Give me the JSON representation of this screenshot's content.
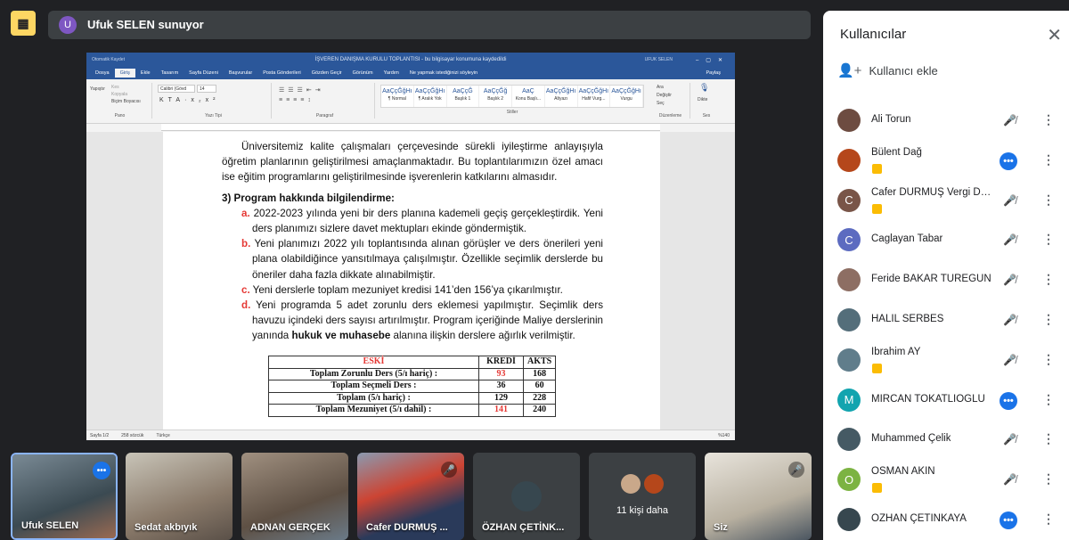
{
  "presenter": {
    "avatar_letter": "U",
    "text": "Ufuk SELEN sunuyor"
  },
  "word": {
    "title": "İŞVEREN DANIŞMA KURULU TOPLANTISI - bu bilgisayar konumuna kaydedildi",
    "user": "UFUK SELEN",
    "autosave": "Otomatik Kaydet",
    "tabs": [
      "Dosya",
      "Giriş",
      "Ekle",
      "Tasarım",
      "Sayfa Düzeni",
      "Başvurular",
      "Posta Gönderileri",
      "Gözden Geçir",
      "Görünüm",
      "Yardım",
      "Ne yapmak istediğinizi söyleyin"
    ],
    "share": "Paylaş",
    "font_name": "Calibri (Gövd",
    "font_size": "14",
    "groups": [
      "Pano",
      "Yazı Tipi",
      "Paragraf",
      "Stiller",
      "Düzenleme",
      "Ses"
    ],
    "clipboard": [
      "Yapıştır",
      "Kes",
      "Kopyala",
      "Biçim Boyacısı"
    ],
    "styles": [
      {
        "sample": "AaÇçĞğHı",
        "name": "¶ Normal"
      },
      {
        "sample": "AaÇçĞğHı",
        "name": "¶ Aralık Yok"
      },
      {
        "sample": "AaÇçĞ",
        "name": "Başlık 1"
      },
      {
        "sample": "AaÇçĞğ",
        "name": "Başlık 2"
      },
      {
        "sample": "AaÇ",
        "name": "Konu Başlı..."
      },
      {
        "sample": "AaÇçĞğHı",
        "name": "Altyazı"
      },
      {
        "sample": "AaÇçĞğHı",
        "name": "Hafif Vurg..."
      },
      {
        "sample": "AaÇçĞğHı",
        "name": "Vurgu"
      }
    ],
    "editing": [
      "Ara",
      "Değiştir",
      "Seç"
    ],
    "dictate": "Dikte",
    "status": [
      "Sayfa 1/2",
      "258 sözcük",
      "Türkçe"
    ],
    "zoom": "%140"
  },
  "document": {
    "intro": "Üniversitemiz kalite çalışmaları çerçevesinde sürekli iyileştirme anlayışıyla öğretim planlarının geliştirilmesi amaçlanmaktadır. Bu toplantılarımızın özel amacı ise eğitim programlarını geliştirilmesinde işverenlerin katkılarını almasıdır.",
    "heading": "3)  Program hakkında bilgilendirme:",
    "items": [
      {
        "marker": "a.",
        "text": " 2022-2023 yılında yeni bir ders planına kademeli geçiş gerçekleştirdik. Yeni ders planımızı sizlere davet mektupları ekinde göndermiştik."
      },
      {
        "marker": "b.",
        "text": " Yeni planımızı 2022 yılı toplantısında alınan görüşler ve ders önerileri yeni plana olabildiğince yansıtılmaya çalışılmıştır. Özellikle seçimlik derslerde bu öneriler daha fazla dikkate alınabilmiştir."
      },
      {
        "marker": "c.",
        "text": " Yeni derslerle toplam mezuniyet kredisi 141’den 156’ya çıkarılmıştır."
      }
    ],
    "item_d": {
      "marker": "d.",
      "pre": " Yeni programda 5 adet zorunlu ders eklemesi yapılmıştır. Seçimlik ders havuzu içindeki ders sayısı artırılmıştır. Program içeriğinde Maliye derslerinin yanında ",
      "bold": "hukuk ve muhasebe",
      "post": " alanına ilişkin derslere ağırlık verilmiştir."
    },
    "table": {
      "headers": [
        "ESKİ",
        "KREDİ",
        "AKTS"
      ],
      "rows": [
        [
          "Toplam Zorunlu Ders  (5/ı hariç) :",
          "93",
          "168"
        ],
        [
          "Toplam Seçmeli Ders  :",
          "36",
          "60"
        ],
        [
          "Toplam  (5/ı hariç)  :",
          "129",
          "228"
        ],
        [
          "Toplam Mezuniyet (5/ı dahil) :",
          "141",
          "240"
        ]
      ]
    }
  },
  "panel": {
    "title": "Kullanıcılar",
    "add_user": "Kullanıcı ekle",
    "participants": [
      {
        "name": "Ali Torun",
        "avatar": "",
        "color": "#6d4c41",
        "badge": false,
        "speaking": false
      },
      {
        "name": "Bülent Dağ",
        "avatar": "",
        "color": "#b5471b",
        "badge": true,
        "speaking": true
      },
      {
        "name": "Cafer DURMUŞ Vergi Den...",
        "avatar": "C",
        "color": "#795548",
        "badge": true,
        "speaking": false
      },
      {
        "name": "Caglayan Tabar",
        "avatar": "C",
        "color": "#5c6bc0",
        "badge": false,
        "speaking": false
      },
      {
        "name": "Feride BAKAR TÜREGÜN",
        "avatar": "",
        "color": "#8d6e63",
        "badge": false,
        "speaking": false
      },
      {
        "name": "HALİL SERBES",
        "avatar": "",
        "color": "#546e7a",
        "badge": false,
        "speaking": false
      },
      {
        "name": "İbrahim AY",
        "avatar": "",
        "color": "#607d8b",
        "badge": true,
        "speaking": false
      },
      {
        "name": "MİRCAN TOKATLIOĞLU",
        "avatar": "M",
        "color": "#12a4af",
        "badge": false,
        "speaking": true
      },
      {
        "name": "Muhammed Çelik",
        "avatar": "",
        "color": "#455a64",
        "badge": false,
        "speaking": false
      },
      {
        "name": "OSMAN AKIN",
        "avatar": "O",
        "color": "#7cb342",
        "badge": true,
        "speaking": false
      },
      {
        "name": "ÖZHAN ÇETİNKAYA",
        "avatar": "",
        "color": "#37474f",
        "badge": false,
        "speaking": true
      }
    ]
  },
  "tiles": [
    {
      "name": "Ufuk SELEN",
      "speaking": true,
      "muted": false
    },
    {
      "name": "Sedat akbıyık",
      "speaking": false,
      "muted": false
    },
    {
      "name": "ADNAN GERÇEK",
      "speaking": false,
      "muted": false
    },
    {
      "name": "Cafer DURMUŞ ...",
      "speaking": false,
      "muted": true
    },
    {
      "name": "ÖZHAN ÇETİNK...",
      "speaking": false,
      "muted": false
    },
    {
      "name": "11 kişi daha",
      "speaking": false,
      "muted": false
    },
    {
      "name": "Siz",
      "speaking": false,
      "muted": true
    }
  ]
}
